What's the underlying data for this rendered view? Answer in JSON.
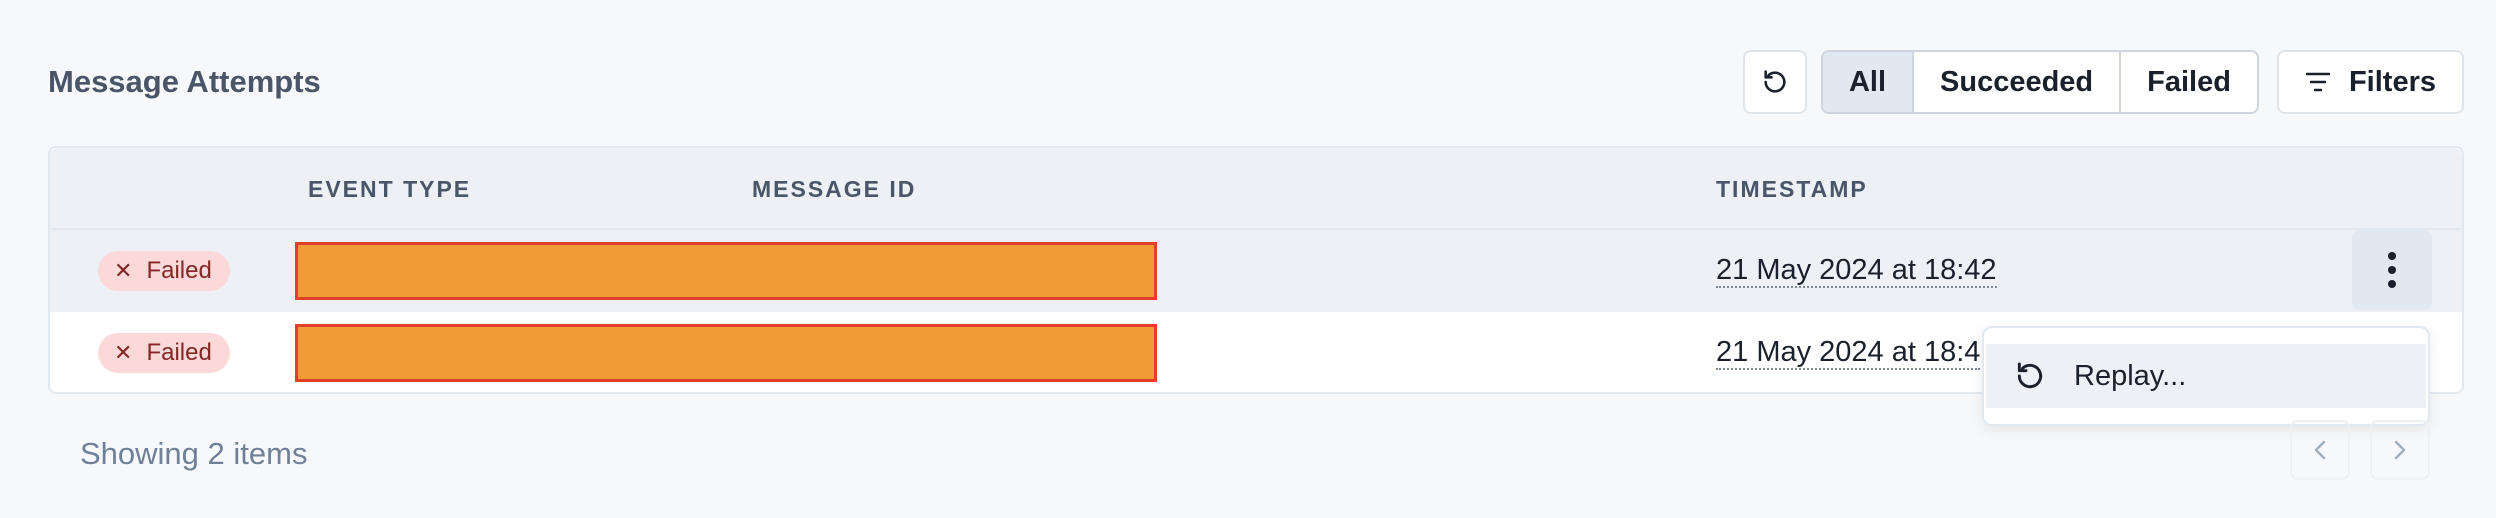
{
  "header": {
    "title": "Message Attempts"
  },
  "toolbar": {
    "refresh_icon": "refresh-icon",
    "segments": [
      "All",
      "Succeeded",
      "Failed"
    ],
    "active_segment": "All",
    "filters_label": "Filters",
    "filters_icon": "filter-icon"
  },
  "table": {
    "columns": [
      "",
      "EVENT TYPE",
      "MESSAGE ID",
      "TIMESTAMP"
    ],
    "rows": [
      {
        "status": "Failed",
        "event_type": "",
        "message_id": "",
        "timestamp": "21 May 2024 at 18:42"
      },
      {
        "status": "Failed",
        "event_type": "",
        "message_id": "",
        "timestamp": "21 May 2024 at 18:4"
      }
    ]
  },
  "context_menu": {
    "items": [
      {
        "label": "Replay...",
        "icon": "replay-icon"
      }
    ]
  },
  "footer": {
    "count_text": "Showing 2 items"
  },
  "colors": {
    "failed_badge_bg": "#fcd9d9",
    "failed_badge_text": "#822727",
    "redaction": "#f19a38"
  }
}
